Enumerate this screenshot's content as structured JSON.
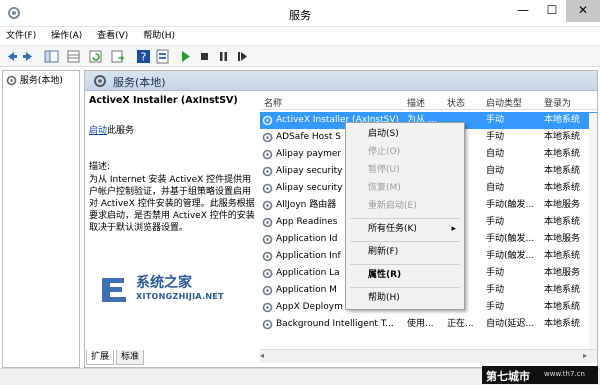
{
  "window": {
    "title": "服务",
    "minimize": "—",
    "maximize": "☐",
    "close": "✕"
  },
  "menubar": [
    "文件(F)",
    "操作(A)",
    "查看(V)",
    "帮助(H)"
  ],
  "colors": {
    "selection": "#3399ff",
    "header": "#c7d6e6",
    "accent_blue": "#1c2f4d"
  },
  "tree": {
    "root": "服务(本地)"
  },
  "panel": {
    "header": "服务(本地)",
    "service_name": "ActiveX Installer (AxInstSV)",
    "start_link": "启动",
    "start_suffix": "此服务",
    "desc_label": "描述:",
    "desc_text": "为从 Internet 安装 ActiveX 控件提供用户帐户控制验证，并基于组策略设置启用对 ActiveX 控件安装的管理。此服务根据要求启动，是否禁用 ActiveX 控件的安装取决于默认浏览器设置。"
  },
  "table": {
    "columns": [
      "名称",
      "描述",
      "状态",
      "启动类型",
      "登录为"
    ],
    "rows": [
      {
        "name": "ActiveX Installer (AxInstSV)",
        "desc": "为从 ...",
        "status": "",
        "startup": "手动",
        "logon": "本地系统",
        "selected": true
      },
      {
        "name": "ADSafe Host S",
        "desc": "",
        "status": "",
        "startup": "手动",
        "logon": "本地系统"
      },
      {
        "name": "Alipay paymer",
        "desc": "",
        "status": "",
        "startup": "自动",
        "logon": "本地系统"
      },
      {
        "name": "Alipay security",
        "desc": "",
        "status": "",
        "startup": "自动",
        "logon": "本地系统"
      },
      {
        "name": "Alipay security",
        "desc": "",
        "status": "",
        "startup": "自动",
        "logon": "本地系统"
      },
      {
        "name": "AllJoyn 路由器",
        "desc": "",
        "status": "",
        "startup": "手动(触发...",
        "logon": "本地服务"
      },
      {
        "name": "App Readines",
        "desc": "",
        "status": "",
        "startup": "手动",
        "logon": "本地系统"
      },
      {
        "name": "Application Id",
        "desc": "",
        "status": "",
        "startup": "手动(触发...",
        "logon": "本地服务"
      },
      {
        "name": "Application Inf",
        "desc": "",
        "status": "",
        "startup": "手动(触发...",
        "logon": "本地系统"
      },
      {
        "name": "Application La",
        "desc": "",
        "status": "",
        "startup": "手动",
        "logon": "本地服务"
      },
      {
        "name": "Application M",
        "desc": "",
        "status": "",
        "startup": "手动",
        "logon": "本地系统"
      },
      {
        "name": "AppX Deploym",
        "desc": "",
        "status": "",
        "startup": "手动",
        "logon": "本地系统"
      },
      {
        "name": "Background Intelligent T...",
        "desc": "使用...",
        "status": "正在...",
        "startup": "自动(延迟...",
        "logon": "本地系统"
      }
    ]
  },
  "context_menu": {
    "items": [
      {
        "label": "启动(S)",
        "disabled": false
      },
      {
        "label": "停止(O)",
        "disabled": true
      },
      {
        "label": "暂停(U)",
        "disabled": true
      },
      {
        "label": "恢复(M)",
        "disabled": true
      },
      {
        "label": "重新启动(E)",
        "disabled": true
      },
      {
        "label": "所有任务(K)",
        "disabled": false,
        "submenu": true
      },
      {
        "label": "刷新(F)",
        "disabled": false
      },
      {
        "label": "属性(R)",
        "disabled": false,
        "bold": true
      },
      {
        "label": "帮助(H)",
        "disabled": false
      }
    ],
    "submenu_arrow": "▸"
  },
  "tabs": [
    "扩展",
    "标准"
  ],
  "watermark": {
    "title": "系统之家",
    "subtitle": "XITONGZHIJIA.NET"
  },
  "brand": {
    "name": "第七城市",
    "url": "www.th7.cn"
  }
}
